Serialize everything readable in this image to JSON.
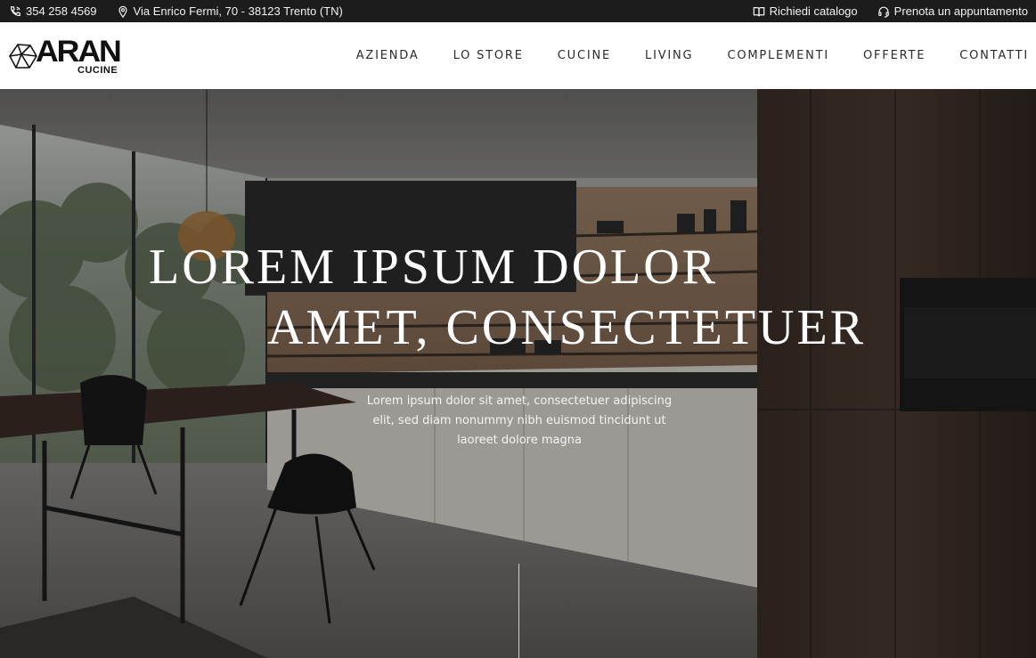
{
  "topbar": {
    "phone": "354 258 4569",
    "address": "Via Enrico Fermi, 70 - 38123 Trento (TN)",
    "catalog": "Richiedi catalogo",
    "appointment": "Prenota un appuntamento",
    "icons": [
      "phone-icon",
      "map-pin-icon",
      "book-icon",
      "headset-icon"
    ]
  },
  "logo": {
    "brand": "ARAN",
    "sub": "CUCINE"
  },
  "nav": {
    "items": [
      "AZIENDA",
      "LO STORE",
      "CUCINE",
      "LIVING",
      "COMPLEMENTI",
      "OFFERTE",
      "CONTATTI"
    ]
  },
  "hero": {
    "headline_line1": "LOREM IPSUM DOLOR",
    "headline_line2": "AMET, CONSECTETUER",
    "lead": "Lorem ipsum dolor sit amet, consectetuer adipiscing elit, sed diam nonummy nibh euismod tincidunt ut laoreet dolore magna"
  },
  "colors": {
    "topbar_bg": "#1c1c1c",
    "header_bg": "#ffffff",
    "nav_text": "#2b2b2b",
    "hero_text": "#ffffff"
  }
}
